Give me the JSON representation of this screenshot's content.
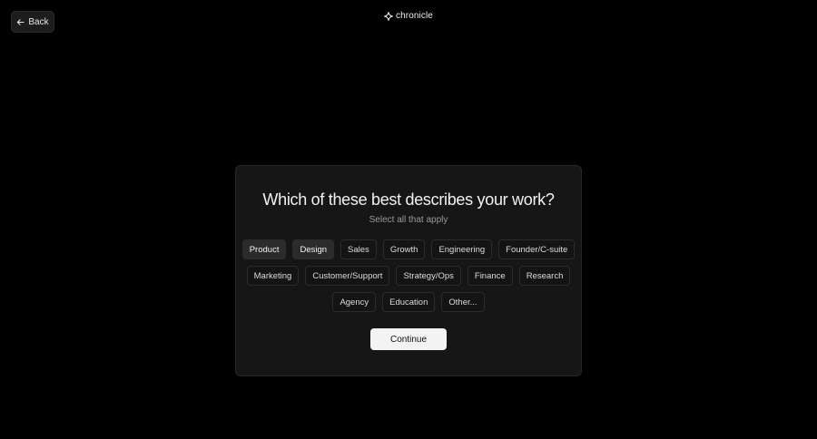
{
  "header": {
    "back_label": "Back",
    "logo_text": "chronicle"
  },
  "card": {
    "title": "Which of these best describes your work?",
    "subtitle": "Select all that apply",
    "rows": [
      [
        {
          "label": "Product",
          "selected": true
        },
        {
          "label": "Design",
          "selected": true
        },
        {
          "label": "Sales",
          "selected": false
        },
        {
          "label": "Growth",
          "selected": false
        },
        {
          "label": "Engineering",
          "selected": false
        },
        {
          "label": "Founder/C-suite",
          "selected": false
        }
      ],
      [
        {
          "label": "Marketing",
          "selected": false
        },
        {
          "label": "Customer/Support",
          "selected": false
        },
        {
          "label": "Strategy/Ops",
          "selected": false
        },
        {
          "label": "Finance",
          "selected": false
        },
        {
          "label": "Research",
          "selected": false
        }
      ],
      [
        {
          "label": "Agency",
          "selected": false
        },
        {
          "label": "Education",
          "selected": false
        },
        {
          "label": "Other...",
          "selected": false
        }
      ]
    ],
    "continue_label": "Continue"
  },
  "colors": {
    "background": "#000000",
    "card": "#161616",
    "chip_selected": "#2b2b2b",
    "button": "#f3f3f3"
  },
  "icons": {
    "back": "arrow-left-icon",
    "logo": "sparkle-icon"
  }
}
